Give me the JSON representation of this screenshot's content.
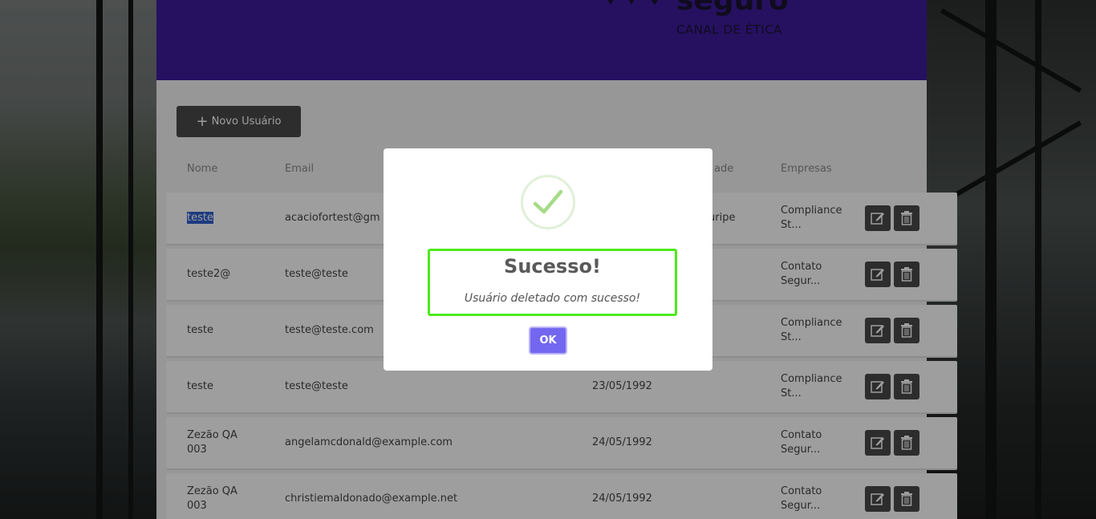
{
  "header": {
    "logo_text": "seguro",
    "subtitle": "CANAL DE ÉTICA"
  },
  "toolbar": {
    "new_user_label": "Novo Usuário"
  },
  "table": {
    "columns": {
      "name": "Nome",
      "email": "Email",
      "city_partial": "ade",
      "companies": "Empresas"
    },
    "rows": [
      {
        "name": "teste",
        "email": "acaciofortest@gm",
        "date": "",
        "city": "uripe",
        "company": "Compliance St..."
      },
      {
        "name": "teste2@",
        "email": "teste@teste",
        "date": "",
        "city": "",
        "company": "Contato Segur..."
      },
      {
        "name": "teste",
        "email": "teste@teste.com",
        "date": "",
        "city": "",
        "company": "Compliance St..."
      },
      {
        "name": "teste",
        "email": "teste@teste",
        "date": "23/05/1992",
        "city": "",
        "company": "Compliance St..."
      },
      {
        "name": "Zezão QA 003",
        "email": "angelamcdonald@example.com",
        "date": "24/05/1992",
        "city": "",
        "company": "Contato Segur..."
      },
      {
        "name": "Zezão QA 003",
        "email": "christiemaldonado@example.net",
        "date": "24/05/1992",
        "city": "",
        "company": "Contato Segur..."
      }
    ]
  },
  "modal": {
    "title": "Sucesso!",
    "message": "Usuário deletado com sucesso!",
    "ok_label": "OK"
  },
  "colors": {
    "header_bg": "#3d1c9c",
    "ok_button": "#7367f0",
    "highlight_border": "#4dea1c",
    "success_check": "#a5dc86"
  }
}
